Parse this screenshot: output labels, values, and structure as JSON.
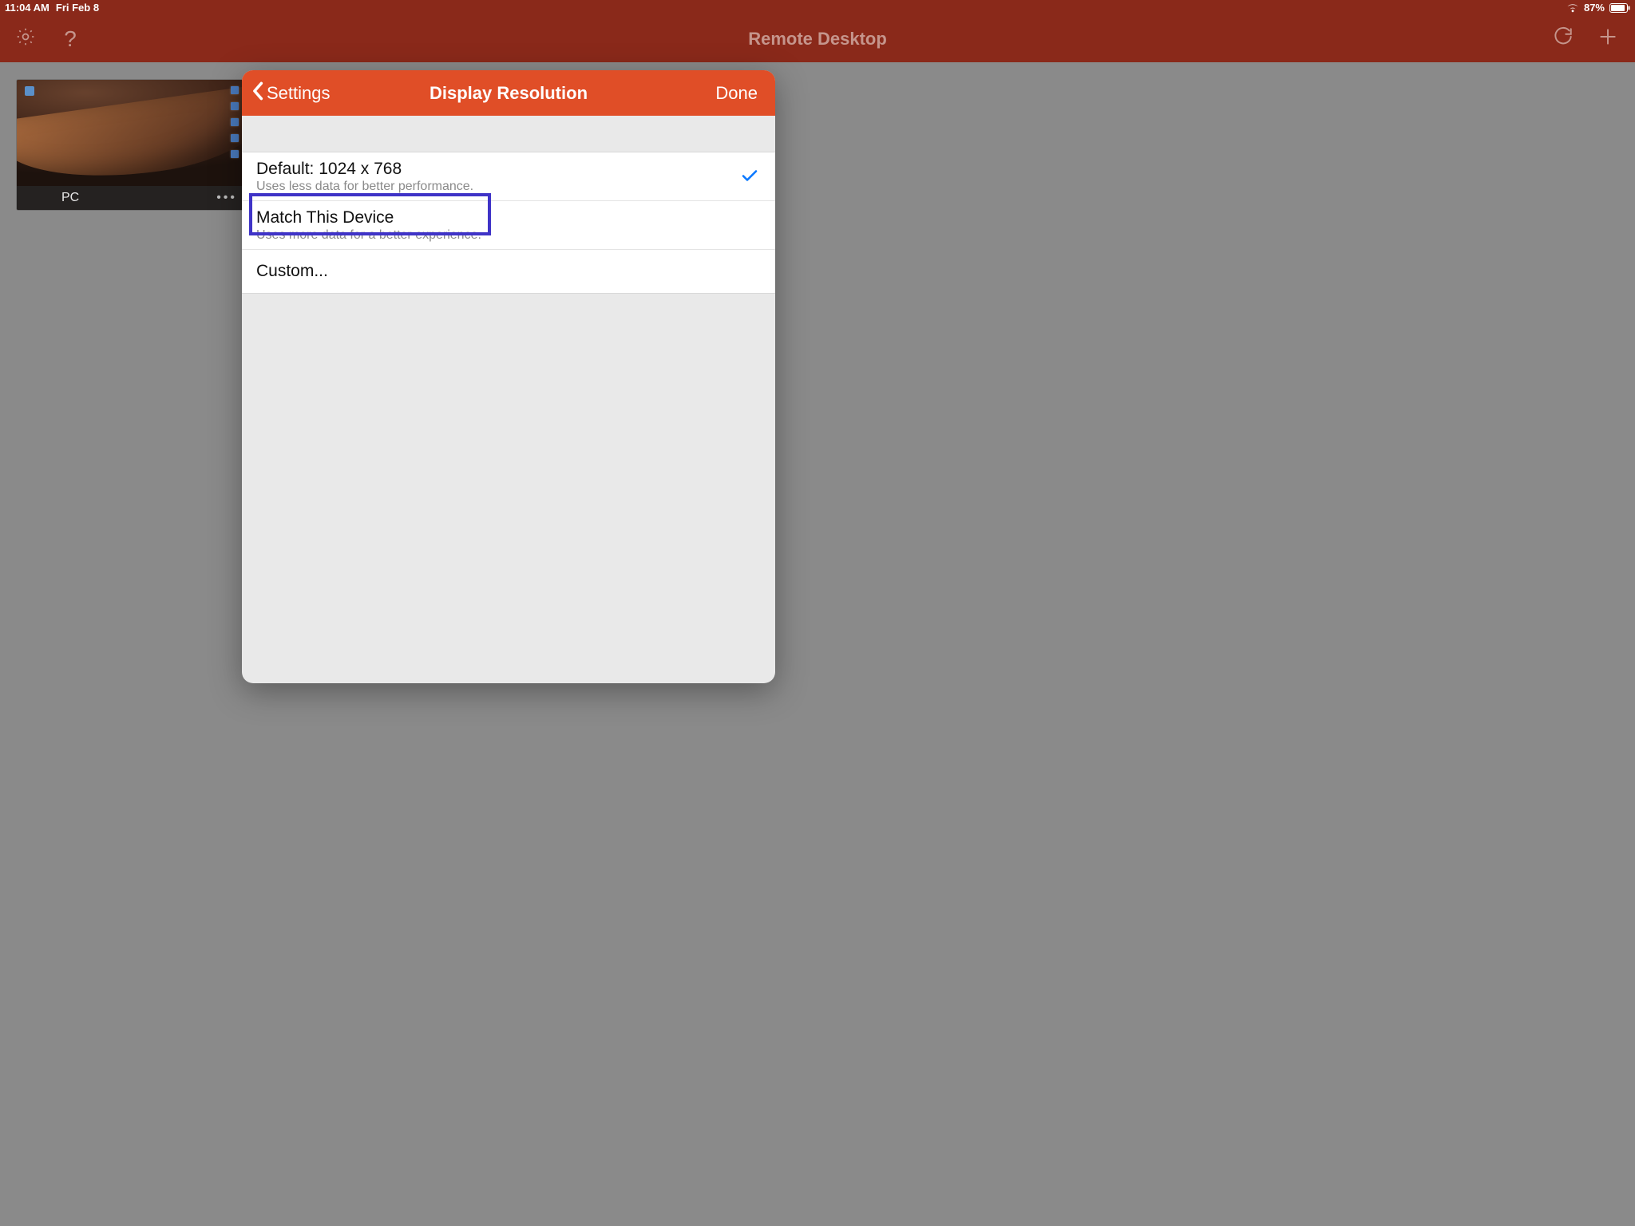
{
  "statusbar": {
    "time": "11:04 AM",
    "date": "Fri Feb 8",
    "battery_pct": "87%"
  },
  "appheader": {
    "title": "Remote Desktop"
  },
  "connection": {
    "label": "PC"
  },
  "modal": {
    "back_label": "Settings",
    "title": "Display Resolution",
    "done_label": "Done",
    "options": [
      {
        "title": "Default: 1024 x 768",
        "subtitle": "Uses less data for better performance.",
        "selected": true
      },
      {
        "title": "Match This Device",
        "subtitle": "Uses more data for a better experience.",
        "selected": false
      },
      {
        "title": "Custom...",
        "subtitle": "",
        "selected": false
      }
    ]
  }
}
